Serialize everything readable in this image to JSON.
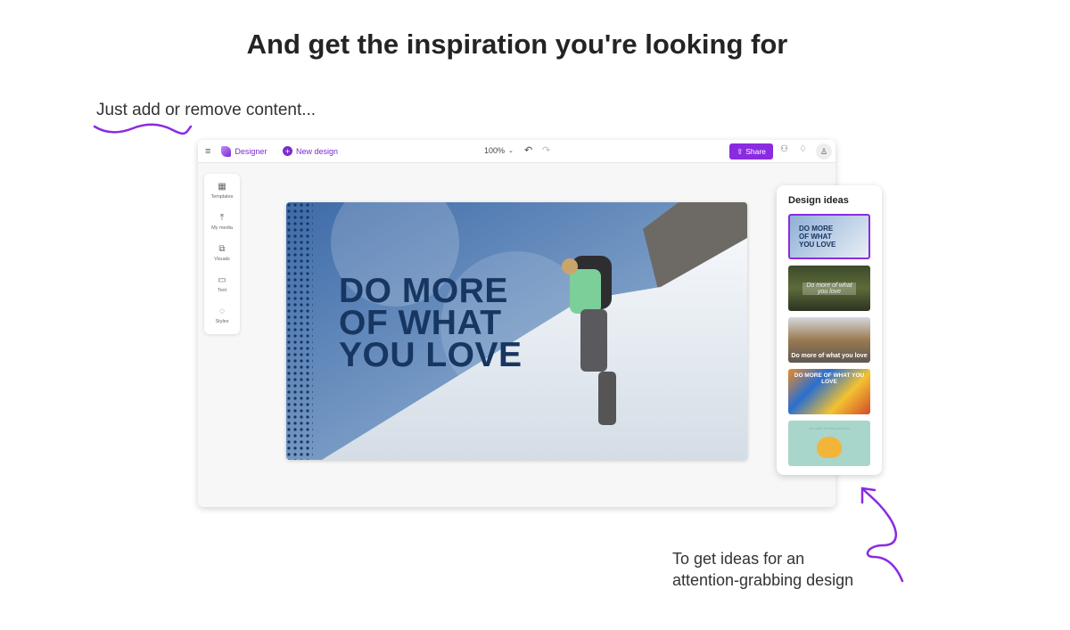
{
  "headline": "And get the inspiration you're looking for",
  "caption_top": "Just add or remove content...",
  "caption_bottom": [
    "To get ideas for an",
    "attention-grabbing design"
  ],
  "app": {
    "name": "Designer",
    "new_design": "New design",
    "zoom": "100%",
    "share": "Share",
    "sidebar": [
      {
        "label": "Templates",
        "icon": "templates-icon"
      },
      {
        "label": "My media",
        "icon": "upload-icon"
      },
      {
        "label": "Visuals",
        "icon": "shapes-icon"
      },
      {
        "label": "Text",
        "icon": "text-icon"
      },
      {
        "label": "Styles",
        "icon": "palette-icon"
      }
    ],
    "canvas_text": [
      "DO MORE",
      "OF WHAT",
      "YOU LOVE"
    ],
    "design_ideas": {
      "title": "Design ideas",
      "items": [
        {
          "text": "DO MORE OF WHAT YOU LOVE"
        },
        {
          "text": "Do more of what you love"
        },
        {
          "text": "Do more of what you love"
        },
        {
          "text": "DO MORE OF WHAT YOU LOVE"
        },
        {
          "text": "Do more of what you love"
        }
      ]
    }
  },
  "colors": {
    "accent": "#8a2be2",
    "navy": "#173661"
  }
}
